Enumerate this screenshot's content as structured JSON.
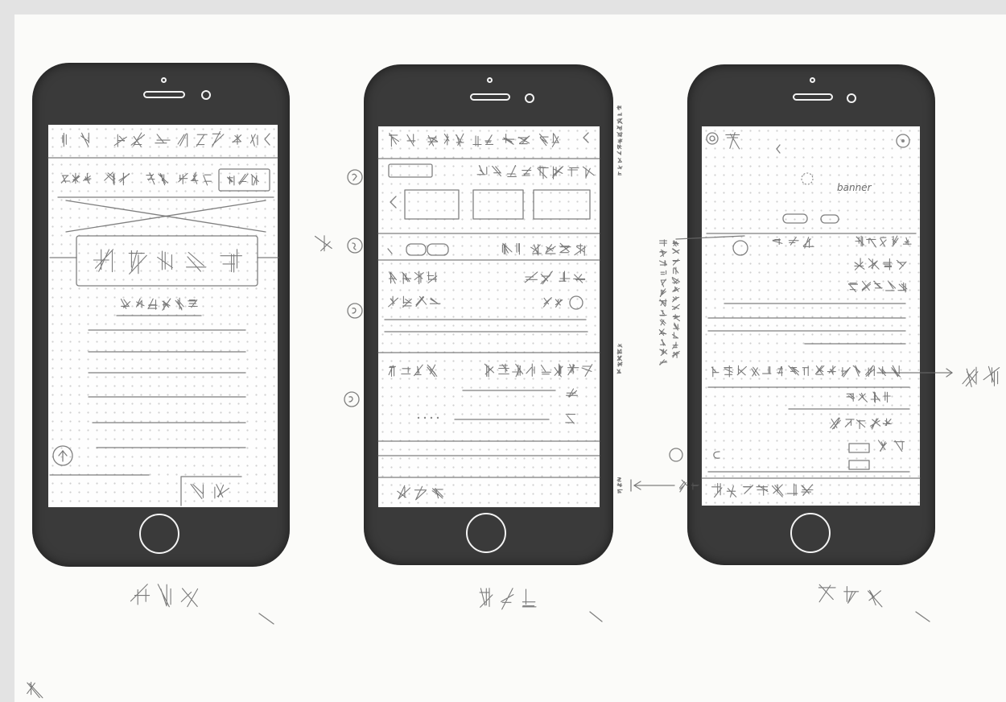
{
  "colors": {
    "paper": "#fbfbf9",
    "scan_border": "#e3e3e3",
    "phone_body": "#3a3a3a",
    "screen": "#fefefe",
    "ink": "#6a6a6a",
    "grid_dot": "#cfcfcf"
  },
  "icons": {
    "home_button": "home-button-icon",
    "back_to_top": "up-arrow-circle-icon",
    "back": "chevron-left-icon",
    "camera": "camera-icon",
    "speaker": "speaker-icon"
  },
  "detail_screen": {
    "banner_label": "banner"
  }
}
